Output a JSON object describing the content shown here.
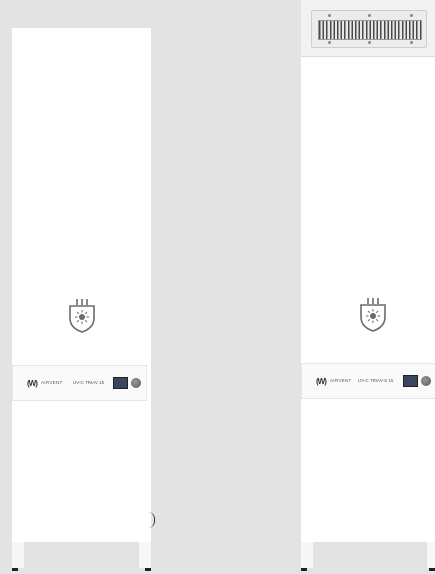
{
  "scene": "Two tall white UV-C air purifier tower units standing on a light grey background",
  "units": [
    {
      "id": "left",
      "brand": "AIRVENT",
      "model": "UV-C TRIAV 15",
      "logo": "(W)",
      "top_grille": false,
      "emblem": "uv-lamp-shield-icon"
    },
    {
      "id": "right",
      "brand": "AIRVENT",
      "model": "UV-C TRIAV-S 15",
      "logo": "(W)",
      "top_grille": true,
      "emblem": "uv-lamp-shield-icon"
    }
  ],
  "colors": {
    "background": "#e3e3e3",
    "cabinet": "#ffffff",
    "display": "#3a4660",
    "emblem_stroke": "#6a6a6a"
  }
}
